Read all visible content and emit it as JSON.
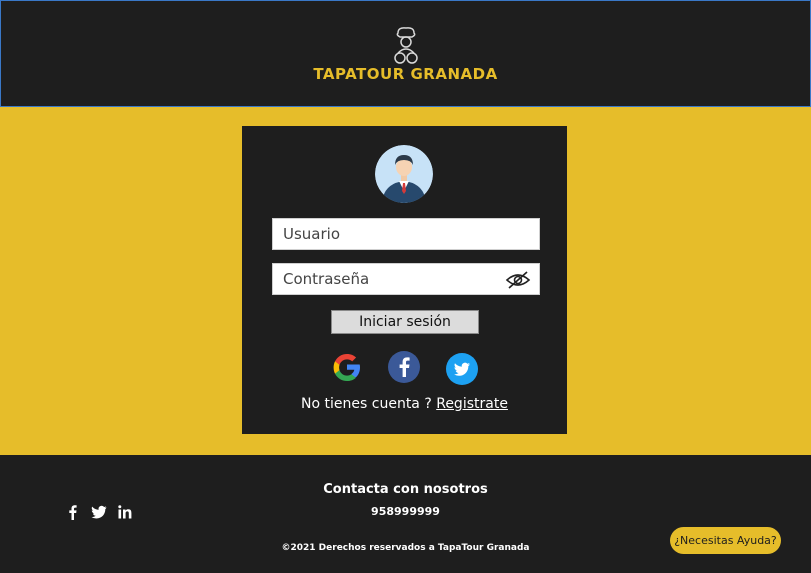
{
  "header": {
    "brand": "TAPATOUR GRANADA",
    "logo_icon": "chef-bike-logo"
  },
  "login": {
    "avatar_icon": "user-avatar",
    "username_placeholder": "Usuario",
    "password_placeholder": "Contraseña",
    "password_toggle_icon": "eye-slash-icon",
    "submit_label": "Iniciar sesión",
    "social": [
      {
        "name": "google",
        "icon": "google-icon",
        "color": "#4285f4"
      },
      {
        "name": "facebook",
        "icon": "facebook-icon",
        "color": "#3b5998"
      },
      {
        "name": "twitter",
        "icon": "twitter-icon",
        "color": "#1da1f2"
      }
    ],
    "no_account_text": "No tienes cuenta ? ",
    "register_link": "Registrate"
  },
  "footer": {
    "title": "Contacta con nosotros",
    "phone": "958999999",
    "copyright": "©2021 Derechos reservados a TapaTour Granada",
    "social_icons": [
      "facebook-icon",
      "twitter-icon",
      "linkedin-icon"
    ],
    "help_button": "¿Necesitas Ayuda?"
  },
  "colors": {
    "accent": "#e6bd2a",
    "dark": "#1e1e1e",
    "header_border": "#3a78c7"
  }
}
